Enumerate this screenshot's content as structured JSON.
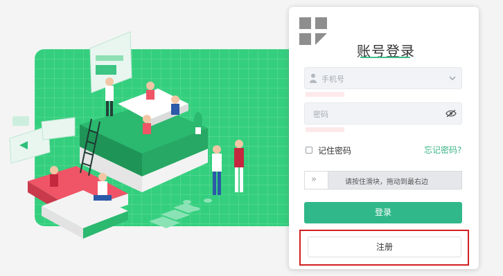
{
  "login": {
    "title": "账号登录",
    "phone_placeholder": "手机号",
    "password_placeholder": "密码",
    "remember_label": "记住密码",
    "forgot_link": "忘记密码?",
    "slider_handle": "»",
    "slider_text": "请按住滑块，拖动到最右边",
    "login_button": "登录",
    "register_button": "注册"
  },
  "colors": {
    "accent": "#31b88a",
    "hero_green": "#34cf7e",
    "highlight": "#d21f1f"
  },
  "icons": [
    "qr-code-icon",
    "user-icon",
    "chevron-down-icon",
    "eye-off-icon"
  ]
}
